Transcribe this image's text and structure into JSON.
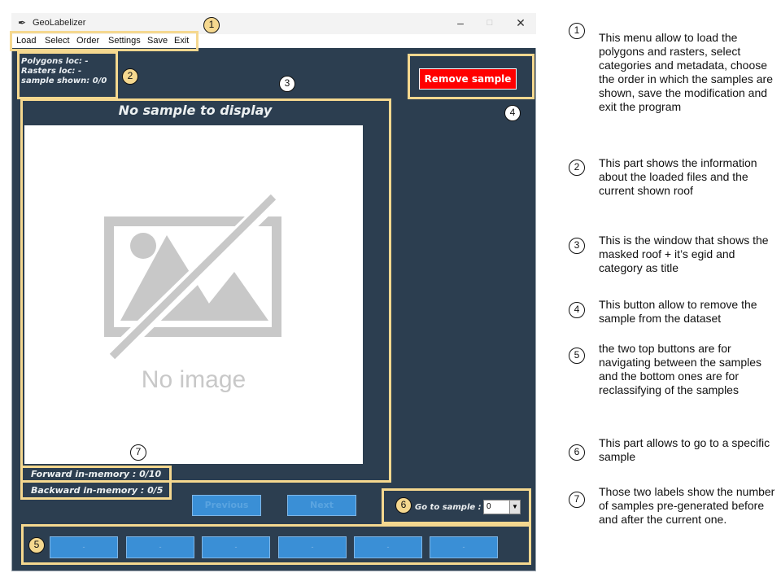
{
  "window": {
    "title": "GeoLabelizer",
    "controls": [
      "–",
      "□",
      "✕"
    ]
  },
  "menu": [
    "Load",
    "Select",
    "Order",
    "Settings",
    "Save",
    "Exit"
  ],
  "info": {
    "polygons": "Polygons loc: -",
    "rasters": "Rasters loc: -",
    "shown": "sample shown: 0/0"
  },
  "remove_button": "Remove sample",
  "sample_title": "No sample to display",
  "placeholder_text": "No image",
  "memory": {
    "forward": "Forward in-memory : 0/10",
    "backward": "Backward in-memory : 0/5"
  },
  "nav": {
    "previous": "Previous",
    "next": "Next"
  },
  "goto": {
    "label": "Go to sample :",
    "value": "0"
  },
  "category_buttons": [
    "-",
    "-",
    "-",
    "-",
    "-",
    "-"
  ],
  "markers": [
    "1",
    "2",
    "3",
    "4",
    "5",
    "6",
    "7"
  ],
  "annotations": [
    {
      "num": "1",
      "text": "This menu allow to load the polygons and rasters, select categories and metadata, choose the order in which the samples are shown, save the modification and exit the program"
    },
    {
      "num": "2",
      "text": "This part shows the information about the loaded files and the current shown roof"
    },
    {
      "num": "3",
      "text": "This is the window that shows the masked roof + it’s egid and category as title"
    },
    {
      "num": "4",
      "text": "This button allow to remove the sample from the dataset"
    },
    {
      "num": "5",
      "text": "the two top buttons are for navigating between the samples and the bottom ones are for reclassifying of the samples"
    },
    {
      "num": "6",
      "text": "This part allows to go to a specific sample"
    },
    {
      "num": "7",
      "text": "Those two labels show the number of samples pre-generated before and after the current one."
    }
  ],
  "colors": {
    "window_bg": "#2c3e50",
    "highlight": "#f5d88f",
    "remove": "#ff0000",
    "nav_button": "#3a8fd6"
  }
}
